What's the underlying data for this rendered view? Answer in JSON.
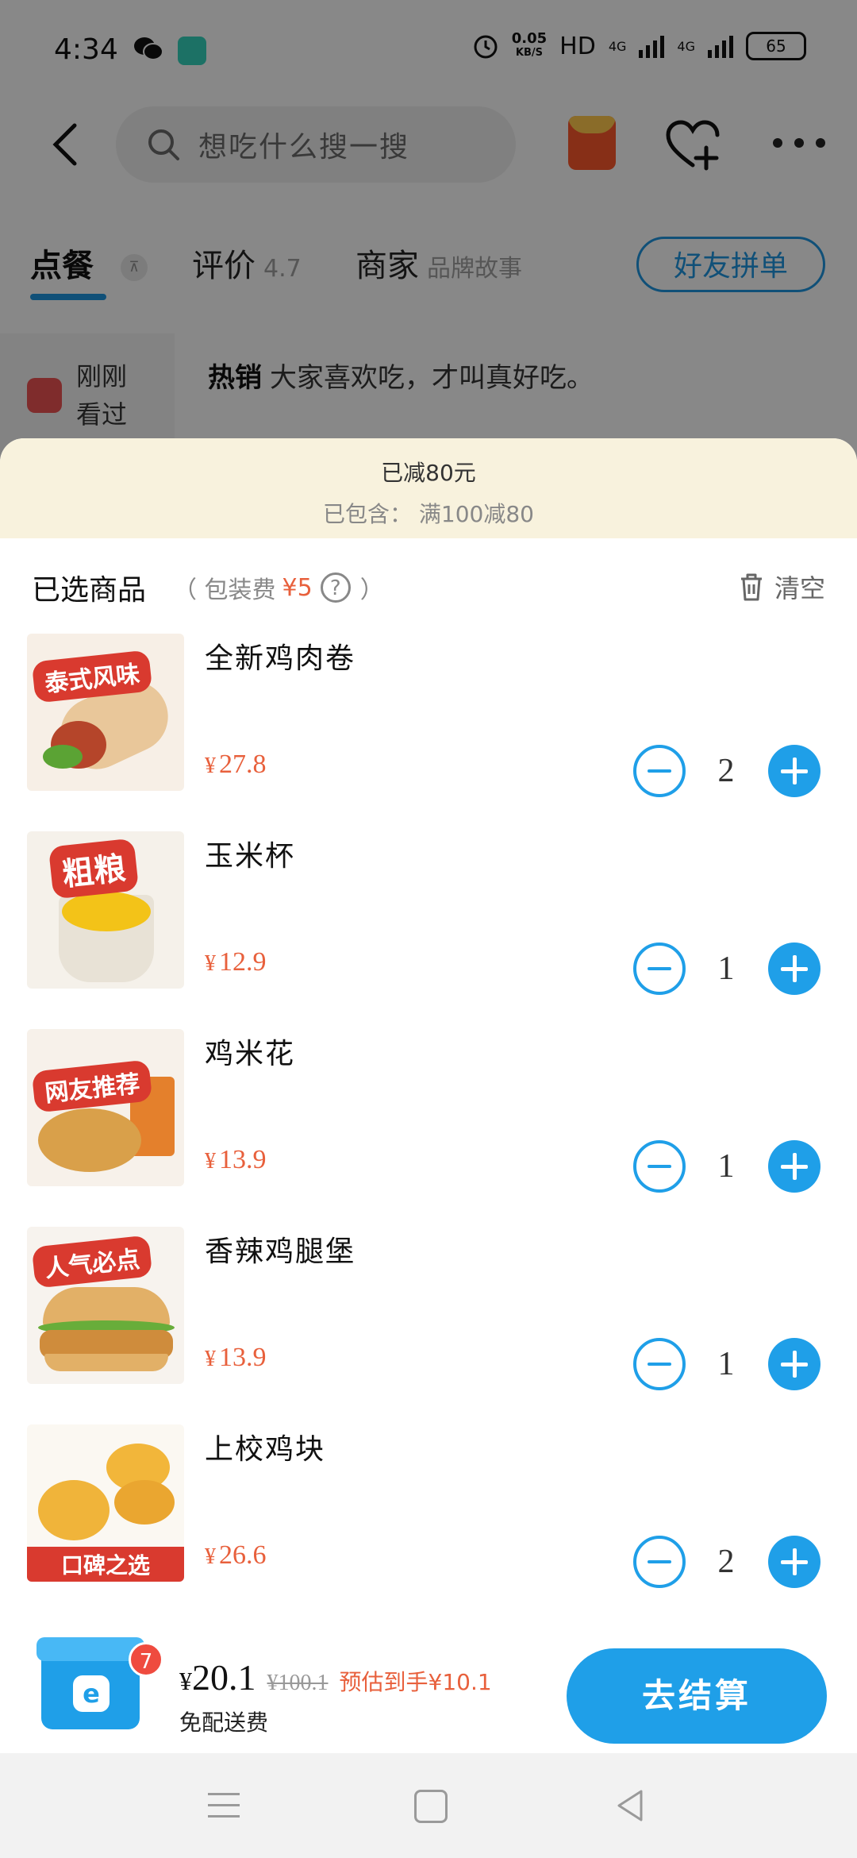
{
  "status_bar": {
    "time": "4:34",
    "net_speed_value": "0.05",
    "net_speed_unit": "KB/S",
    "hd": "HD",
    "signal1": "4G",
    "signal2": "4G",
    "battery": "65"
  },
  "top_nav": {
    "search_placeholder": "想吃什么搜一搜"
  },
  "tabs": {
    "order": "点餐",
    "review": "评价",
    "review_score": "4.7",
    "shop": "商家",
    "shop_sub": "品牌故事",
    "group_order": "好友拼单"
  },
  "background": {
    "recent_label": "刚刚看过",
    "hot_title": "热销",
    "hot_slogan": "大家喜欢吃，才叫真好吃。"
  },
  "discount": {
    "title": "已减80元",
    "detail": "已包含：  满100减80"
  },
  "cart": {
    "title": "已选商品",
    "packing_label": "（ 包装费",
    "packing_price": "¥5",
    "packing_close": "）",
    "help": "?",
    "clear": "清空",
    "items": [
      {
        "name": "全新鸡肉卷",
        "currency": "¥",
        "price": "27.8",
        "qty": "2",
        "tag": "泰式风味"
      },
      {
        "name": "玉米杯",
        "currency": "¥",
        "price": "12.9",
        "qty": "1",
        "tag": "粗粮"
      },
      {
        "name": "鸡米花",
        "currency": "¥",
        "price": "13.9",
        "qty": "1",
        "tag": "网友推荐"
      },
      {
        "name": "香辣鸡腿堡",
        "currency": "¥",
        "price": "13.9",
        "qty": "1",
        "tag": "人气必点"
      },
      {
        "name": "上校鸡块",
        "currency": "¥",
        "price": "26.6",
        "qty": "2",
        "tag": "口碑之选"
      }
    ]
  },
  "checkout": {
    "badge": "7",
    "logo": "e",
    "currency": "¥",
    "total": "20.1",
    "original": "¥100.1",
    "estimate": "预估到手¥10.1",
    "delivery": "免配送费",
    "button": "去结算"
  },
  "colors": {
    "accent": "#1f9fe8",
    "price": "#e8603c",
    "banner_bg": "#f8f2dd"
  }
}
